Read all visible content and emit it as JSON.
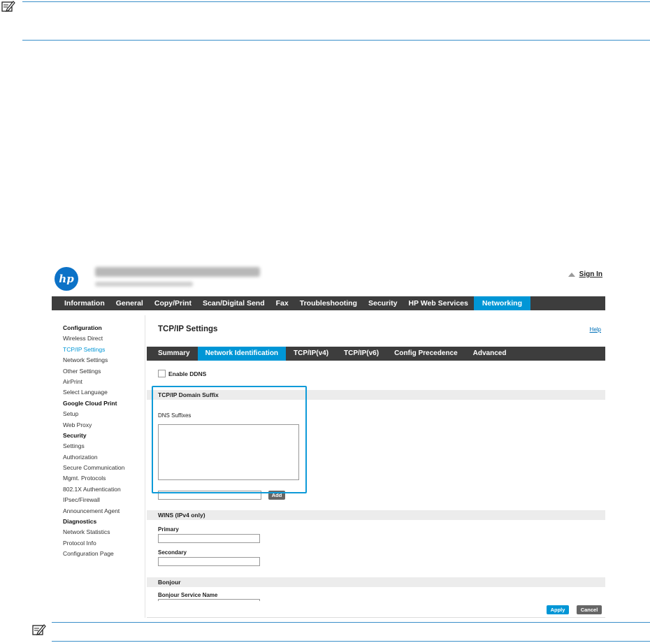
{
  "ews": {
    "logo_text": "hp",
    "sign_in": "Sign In",
    "top_nav": [
      "Information",
      "General",
      "Copy/Print",
      "Scan/Digital Send",
      "Fax",
      "Troubleshooting",
      "Security",
      "HP Web Services",
      "Networking"
    ],
    "sidebar": [
      {
        "label": "Configuration",
        "type": "head"
      },
      {
        "label": "Wireless Direct",
        "type": "item"
      },
      {
        "label": "TCP/IP Settings",
        "type": "active"
      },
      {
        "label": "Network Settings",
        "type": "item"
      },
      {
        "label": "Other Settings",
        "type": "item"
      },
      {
        "label": "AirPrint",
        "type": "item"
      },
      {
        "label": "Select Language",
        "type": "item"
      },
      {
        "label": "Google Cloud Print",
        "type": "head"
      },
      {
        "label": "Setup",
        "type": "item"
      },
      {
        "label": "Web Proxy",
        "type": "item"
      },
      {
        "label": "Security",
        "type": "head"
      },
      {
        "label": "Settings",
        "type": "item"
      },
      {
        "label": "Authorization",
        "type": "item"
      },
      {
        "label": "Secure Communication",
        "type": "item"
      },
      {
        "label": "Mgmt. Protocols",
        "type": "item"
      },
      {
        "label": "802.1X Authentication",
        "type": "item"
      },
      {
        "label": "IPsec/Firewall",
        "type": "item"
      },
      {
        "label": "Announcement Agent",
        "type": "item"
      },
      {
        "label": "Diagnostics",
        "type": "head"
      },
      {
        "label": "Network Statistics",
        "type": "item"
      },
      {
        "label": "Protocol Info",
        "type": "item"
      },
      {
        "label": "Configuration Page",
        "type": "item"
      }
    ],
    "page_title": "TCP/IP Settings",
    "help": "Help",
    "sub_tabs": [
      "Summary",
      "Network Identification",
      "TCP/IP(v4)",
      "TCP/IP(v6)",
      "Config Precedence",
      "Advanced"
    ],
    "enable_ddns": "Enable DDNS",
    "domain_suffix_header": "TCP/IP Domain Suffix",
    "dns_suffixes_label": "DNS Suffixes",
    "add_button": "Add",
    "wins_header": "WINS (IPv4 only)",
    "primary_label": "Primary",
    "secondary_label": "Secondary",
    "bonjour_header": "Bonjour",
    "bonjour_service_label": "Bonjour Service Name",
    "apply_button": "Apply",
    "cancel_button": "Cancel"
  }
}
